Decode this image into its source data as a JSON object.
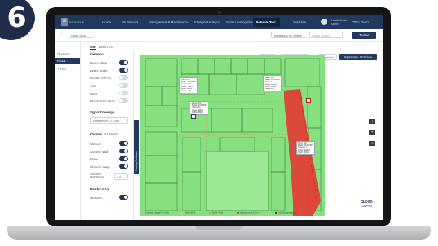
{
  "step_badge": "6",
  "topbar": {
    "logo_text": "Wireless ▾",
    "nav": [
      "Home",
      "My Network",
      "Management & Maintenance",
      "Intelligent Analysis",
      "System Management",
      "Network Task"
    ],
    "active_index": 5,
    "right_items": [
      "Your Site",
      "Office Demo"
    ],
    "user_lines": [
      "Administrator",
      "Admin"
    ]
  },
  "toolbar": {
    "site_select": "Office Demo",
    "search_select": "Dangerous Wi-Fi table",
    "search_placeholder": "Please search...",
    "action_button": "Toolbar"
  },
  "left_nav": {
    "items": [
      "Overview",
      "Floor1",
      "+ Floor"
    ],
    "active_index": 1
  },
  "panel": {
    "tabs": [
      "Map",
      "Device List"
    ],
    "active_tab": 0,
    "common": {
      "title": "Common",
      "rows": [
        {
          "label": "Device Name",
          "on": true
        },
        {
          "label": "Device Model",
          "on": true
        },
        {
          "label": "Number of STAs",
          "on": false
        },
        {
          "label": "Alert",
          "on": false
        },
        {
          "label": "LEDs",
          "on": false
        },
        {
          "label": "Unauthorized Wi-Fi",
          "on": false
        }
      ]
    },
    "signal": {
      "title": "Signal Coverage",
      "field": "Interference (2.4 GHz)..."
    },
    "channel": {
      "title": "Channel",
      "filter": "All Radios",
      "rows": [
        {
          "label": "Channel",
          "on": true
        },
        {
          "label": "Channel Width",
          "on": true
        },
        {
          "label": "Power",
          "on": true
        },
        {
          "label": "Channel Usage",
          "on": true
        }
      ],
      "dist_label": "Channel Distribution",
      "dist_field": "2.4G"
    },
    "display": {
      "title": "Display View",
      "rows": [
        {
          "label": "Obstacles",
          "on": true
        }
      ]
    },
    "side_tab": "Display Settings"
  },
  "map_controls": {
    "buttons": [
      "Add Device",
      "Edit the floor plan",
      "Optimize",
      "Experience Overview"
    ]
  },
  "tooltips": [
    {
      "lines": [
        "Name: AP1",
        "Model: AP7060DN",
        "Channel: 11",
        "Power: 20dBm",
        "Width: 20MHz",
        "Usage: 12%"
      ]
    },
    {
      "lines": [
        "Name: AP2",
        "Model: AP7060DN",
        "Channel: 6",
        "Power: 20dBm",
        "Width: 20MHz"
      ]
    },
    {
      "lines": [
        "Name: AP3",
        "Model: AP7060DN",
        "Channel: 1",
        "Power: 18dBm",
        "Width: 20MHz",
        "Usage: 8%"
      ]
    },
    {
      "lines": [
        "Name: AP4",
        "Model: AP7060DN",
        "Channel: 1",
        "Power: 20dBm",
        "Width: 20MHz"
      ]
    }
  ],
  "legend": {
    "items": [
      "Channel Usage: 0~30%",
      "30%~50%",
      "50%~70%",
      "Interference 70%+",
      "100% Interference"
    ],
    "colors": [
      "#86e07f",
      "#f2c14e",
      "#f08a3c",
      "#e53935",
      "#c00000"
    ]
  },
  "brand": [
    "CLOUD",
    "CAMPUS"
  ],
  "colors": {
    "navy": "#22395e",
    "coverage_green": "#86e07f",
    "interference_red": "#e53935"
  }
}
